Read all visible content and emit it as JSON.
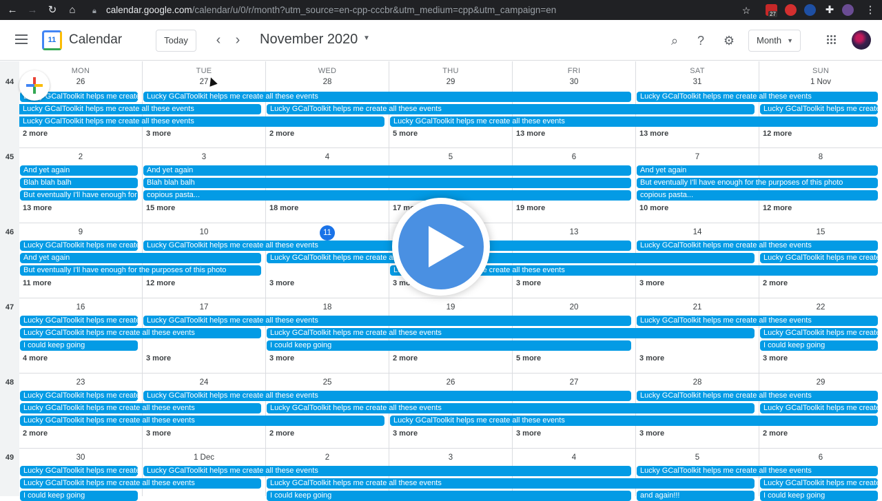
{
  "browser": {
    "url_host": "calendar.google.com",
    "url_path": "/calendar/u/0/r/month?utm_source=en-cpp-cccbr&utm_medium=cpp&utm_campaign=en",
    "extension_badge": "27"
  },
  "header": {
    "app_title": "Calendar",
    "logo_day": "11",
    "today_label": "Today",
    "prev_label": "‹",
    "next_label": "›",
    "month_title": "November 2020",
    "view_label": "Month"
  },
  "days_of_week": [
    "MON",
    "TUE",
    "WED",
    "THU",
    "FRI",
    "SAT",
    "SUN"
  ],
  "weeks": [
    {
      "number": "44",
      "days": [
        "26",
        "27",
        "28",
        "29",
        "30",
        "31",
        "1 Nov"
      ],
      "more": [
        "2 more",
        "3 more",
        "2 more",
        "5 more",
        "13 more",
        "13 more",
        "12 more"
      ],
      "events": [
        {
          "row": 0,
          "start": 0,
          "span": 1,
          "text": "Lucky GCalToolkit helps me create all these events"
        },
        {
          "row": 0,
          "start": 1,
          "span": 4,
          "text": "Lucky GCalToolkit helps me create all these events"
        },
        {
          "row": 0,
          "start": 5,
          "span": 2,
          "text": "Lucky GCalToolkit helps me create all these events"
        },
        {
          "row": 1,
          "start": 0,
          "span": 2,
          "text": "Lucky GCalToolkit helps me create all these events",
          "cont": true
        },
        {
          "row": 1,
          "start": 2,
          "span": 4,
          "text": "Lucky GCalToolkit helps me create all these events"
        },
        {
          "row": 1,
          "start": 6,
          "span": 1,
          "text": "Lucky GCalToolkit helps me create all these events"
        },
        {
          "row": 2,
          "start": 0,
          "span": 3,
          "text": "Lucky GCalToolkit helps me create all these events",
          "cont": true
        },
        {
          "row": 2,
          "start": 3,
          "span": 4,
          "text": "Lucky GCalToolkit helps me create all these events"
        }
      ]
    },
    {
      "number": "45",
      "days": [
        "2",
        "3",
        "4",
        "5",
        "6",
        "7",
        "8"
      ],
      "more": [
        "13 more",
        "15 more",
        "18 more",
        "17 more",
        "19 more",
        "10 more",
        "12 more"
      ],
      "events": [
        {
          "row": 0,
          "start": 0,
          "span": 1,
          "text": "And yet again"
        },
        {
          "row": 0,
          "start": 1,
          "span": 4,
          "text": "And yet again"
        },
        {
          "row": 0,
          "start": 5,
          "span": 2,
          "text": "And yet again"
        },
        {
          "row": 1,
          "start": 0,
          "span": 1,
          "text": "Blah blah balh"
        },
        {
          "row": 1,
          "start": 1,
          "span": 4,
          "text": "Blah blah balh"
        },
        {
          "row": 1,
          "start": 5,
          "span": 2,
          "text": "But eventually I'll have enough for the purposes of this photo"
        },
        {
          "row": 2,
          "start": 0,
          "span": 1,
          "text": "But eventually I'll have enough for the purposes of this photo"
        },
        {
          "row": 2,
          "start": 1,
          "span": 4,
          "text": "copious pasta..."
        },
        {
          "row": 2,
          "start": 5,
          "span": 2,
          "text": "copious pasta..."
        }
      ]
    },
    {
      "number": "46",
      "days": [
        "9",
        "10",
        "11",
        "12",
        "13",
        "14",
        "15"
      ],
      "today_index": 2,
      "more": [
        "11 more",
        "12 more",
        "3 more",
        "3 more",
        "3 more",
        "3 more",
        "2 more"
      ],
      "events": [
        {
          "row": 0,
          "start": 0,
          "span": 1,
          "text": "Lucky GCalToolkit helps me create all these events"
        },
        {
          "row": 0,
          "start": 1,
          "span": 4,
          "text": "Lucky GCalToolkit helps me create all these events"
        },
        {
          "row": 0,
          "start": 5,
          "span": 2,
          "text": "Lucky GCalToolkit helps me create all these events"
        },
        {
          "row": 1,
          "start": 0,
          "span": 2,
          "text": "And yet again"
        },
        {
          "row": 1,
          "start": 2,
          "span": 4,
          "text": "Lucky GCalToolkit helps me create all these events"
        },
        {
          "row": 1,
          "start": 6,
          "span": 1,
          "text": "Lucky GCalToolkit helps me create all these events"
        },
        {
          "row": 2,
          "start": 0,
          "span": 2,
          "text": "But eventually I'll have enough for the purposes of this photo"
        },
        {
          "row": 2,
          "start": 3,
          "span": 4,
          "text": "Lucky GCalToolkit helps me create all these events"
        }
      ]
    },
    {
      "number": "47",
      "days": [
        "16",
        "17",
        "18",
        "19",
        "20",
        "21",
        "22"
      ],
      "more": [
        "4 more",
        "3 more",
        "3 more",
        "2 more",
        "5 more",
        "3 more",
        "3 more"
      ],
      "events": [
        {
          "row": 0,
          "start": 0,
          "span": 1,
          "text": "Lucky GCalToolkit helps me create all these events"
        },
        {
          "row": 0,
          "start": 1,
          "span": 4,
          "text": "Lucky GCalToolkit helps me create all these events"
        },
        {
          "row": 0,
          "start": 5,
          "span": 2,
          "text": "Lucky GCalToolkit helps me create all these events"
        },
        {
          "row": 1,
          "start": 0,
          "span": 2,
          "text": "Lucky GCalToolkit helps me create all these events"
        },
        {
          "row": 1,
          "start": 2,
          "span": 4,
          "text": "Lucky GCalToolkit helps me create all these events"
        },
        {
          "row": 1,
          "start": 6,
          "span": 1,
          "text": "Lucky GCalToolkit helps me create all these events"
        },
        {
          "row": 2,
          "start": 0,
          "span": 1,
          "text": "I could keep going"
        },
        {
          "row": 2,
          "start": 2,
          "span": 3,
          "text": "I could keep going"
        },
        {
          "row": 2,
          "start": 6,
          "span": 1,
          "text": "I could keep going"
        }
      ]
    },
    {
      "number": "48",
      "days": [
        "23",
        "24",
        "25",
        "26",
        "27",
        "28",
        "29"
      ],
      "more": [
        "2 more",
        "3 more",
        "2 more",
        "3 more",
        "3 more",
        "3 more",
        "2 more"
      ],
      "events": [
        {
          "row": 0,
          "start": 0,
          "span": 1,
          "text": "Lucky GCalToolkit helps me create all these events"
        },
        {
          "row": 0,
          "start": 1,
          "span": 4,
          "text": "Lucky GCalToolkit helps me create all these events"
        },
        {
          "row": 0,
          "start": 5,
          "span": 2,
          "text": "Lucky GCalToolkit helps me create all these events"
        },
        {
          "row": 1,
          "start": 0,
          "span": 2,
          "text": "Lucky GCalToolkit helps me create all these events"
        },
        {
          "row": 1,
          "start": 2,
          "span": 4,
          "text": "Lucky GCalToolkit helps me create all these events"
        },
        {
          "row": 1,
          "start": 6,
          "span": 1,
          "text": "Lucky GCalToolkit helps me create all these events"
        },
        {
          "row": 2,
          "start": 0,
          "span": 3,
          "text": "Lucky GCalToolkit helps me create all these events"
        },
        {
          "row": 2,
          "start": 3,
          "span": 4,
          "text": "Lucky GCalToolkit helps me create all these events"
        }
      ]
    },
    {
      "number": "49",
      "days": [
        "30",
        "1 Dec",
        "2",
        "3",
        "4",
        "5",
        "6"
      ],
      "more": [],
      "events": [
        {
          "row": 0,
          "start": 0,
          "span": 1,
          "text": "Lucky GCalToolkit helps me create all these events"
        },
        {
          "row": 0,
          "start": 1,
          "span": 4,
          "text": "Lucky GCalToolkit helps me create all these events"
        },
        {
          "row": 0,
          "start": 5,
          "span": 2,
          "text": "Lucky GCalToolkit helps me create all these events"
        },
        {
          "row": 1,
          "start": 0,
          "span": 2,
          "text": "Lucky GCalToolkit helps me create all these events"
        },
        {
          "row": 1,
          "start": 2,
          "span": 4,
          "text": "Lucky GCalToolkit helps me create all these events"
        },
        {
          "row": 1,
          "start": 6,
          "span": 1,
          "text": "Lucky GCalToolkit helps me create all these events"
        },
        {
          "row": 2,
          "start": 0,
          "span": 1,
          "text": "I could keep going"
        },
        {
          "row": 2,
          "start": 2,
          "span": 3,
          "text": "I could keep going"
        },
        {
          "row": 2,
          "start": 5,
          "span": 1,
          "text": "and again!!!"
        },
        {
          "row": 2,
          "start": 6,
          "span": 1,
          "text": "I could keep going"
        }
      ]
    }
  ],
  "colors": {
    "event": "#039be5",
    "today": "#1a73e8",
    "play_overlay": "#4a90e2"
  }
}
